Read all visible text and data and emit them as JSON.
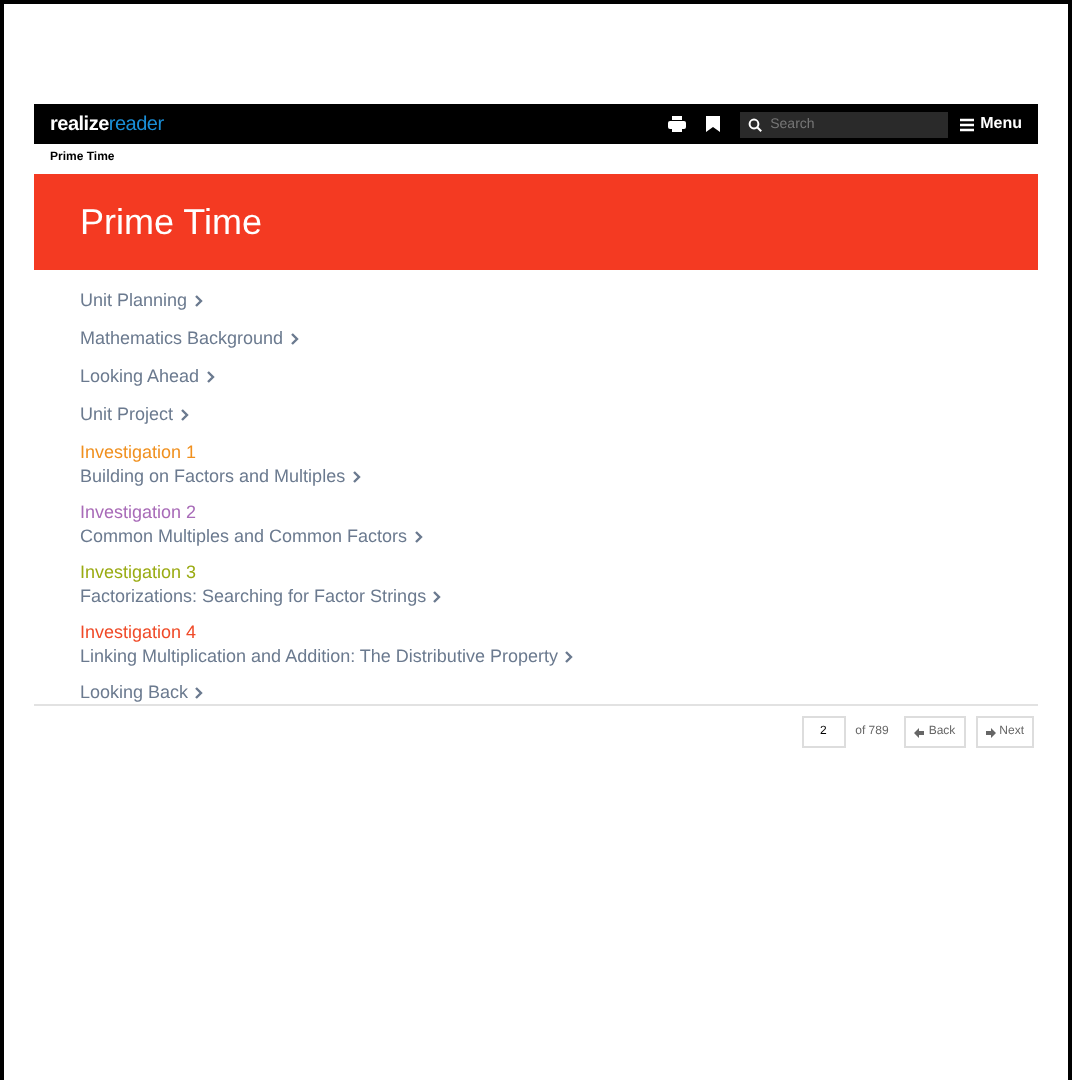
{
  "header": {
    "logo_part_1": "realize",
    "logo_part_2": "reader",
    "search": {
      "placeholder": "Search"
    },
    "menu": "Menu"
  },
  "breadcrumb": "Prime Time",
  "banner": {
    "title": "Prime Time"
  },
  "toc": [
    {
      "kind": "link",
      "label": "Unit Planning"
    },
    {
      "kind": "link",
      "label": "Mathematics Background"
    },
    {
      "kind": "link",
      "label": "Looking Ahead"
    },
    {
      "kind": "link",
      "label": "Unit Project"
    },
    {
      "kind": "section",
      "heading": "Investigation 1",
      "color": "#f0901e",
      "label": "Building on Factors and Multiples"
    },
    {
      "kind": "section",
      "heading": "Investigation 2",
      "color": "#a86bb8",
      "label": "Common Multiples and Common Factors"
    },
    {
      "kind": "section",
      "heading": "Investigation 3",
      "color": "#9aab12",
      "label": "Factorizations: Searching for Factor Strings"
    },
    {
      "kind": "section",
      "heading": "Investigation 4",
      "color": "#f04a28",
      "label": "Linking Multiplication and Addition: The Distributive Property"
    },
    {
      "kind": "link",
      "label": "Looking Back"
    }
  ],
  "pager": {
    "page": "2",
    "total": "of 789",
    "back": "Back",
    "next": "Next"
  }
}
